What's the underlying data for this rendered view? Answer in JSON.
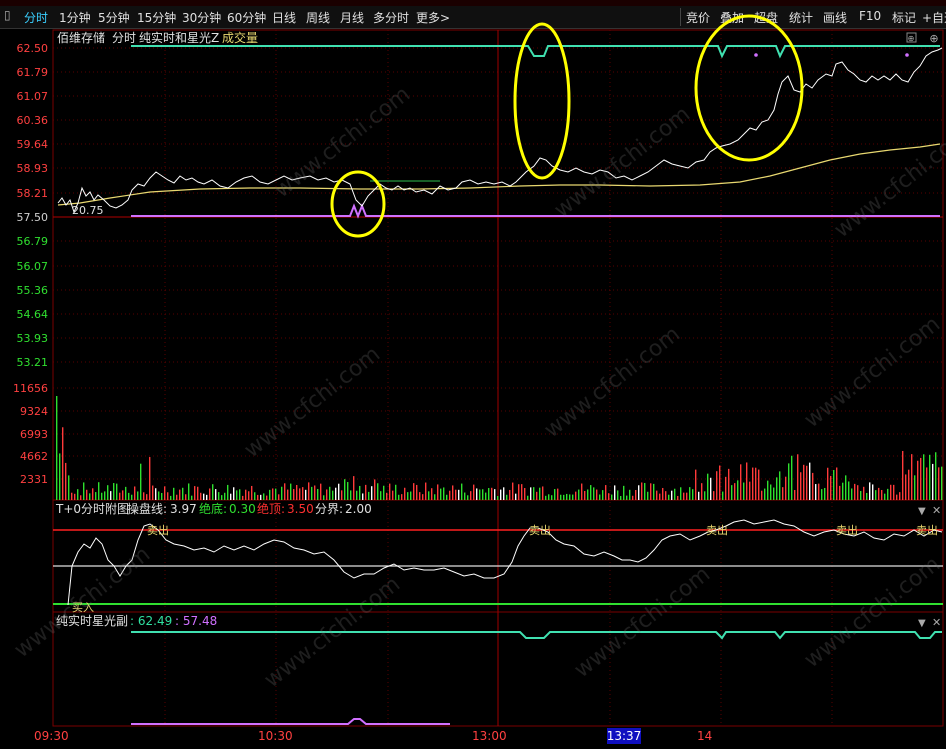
{
  "toolbar": {
    "tabs": [
      "分时",
      "1分钟",
      "5分钟",
      "15分钟",
      "30分钟",
      "60分钟",
      "日线",
      "周线",
      "月线",
      "多分时",
      "更多>"
    ],
    "right_tools": [
      "竞价",
      "叠加",
      "超盘",
      "统计",
      "画线",
      "F10",
      "标记",
      "+自选"
    ]
  },
  "main_panel": {
    "stock_name": "佰维存储",
    "indicator_names": [
      "分时",
      "纯实时和星光Z",
      "成交量"
    ],
    "price_ticks": [
      "62.50",
      "61.79",
      "61.07",
      "60.36",
      "59.64",
      "58.93",
      "58.21",
      "57.50",
      "56.79",
      "56.07",
      "55.36",
      "54.64",
      "53.93",
      "53.21"
    ],
    "pivot_label": "20.75",
    "volume_ticks": [
      "11656",
      "9324",
      "6993",
      "4662",
      "2331"
    ]
  },
  "sub_panel_1": {
    "title": "T+0分时附图",
    "items": [
      {
        "label": "操盘线:",
        "value": "3.97"
      },
      {
        "label": "绝底:",
        "value": "0.30"
      },
      {
        "label": "绝顶:",
        "value": "3.50"
      },
      {
        "label": "分界:",
        "value": "2.00"
      }
    ],
    "signals": [
      "卖出",
      "卖出",
      "卖出",
      "卖出",
      "卖出",
      "买入"
    ]
  },
  "sub_panel_2": {
    "title": "纯实时星光副",
    "values": [
      "62.49",
      "57.48"
    ]
  },
  "time_axis": {
    "labels": [
      "09:30",
      "10:30",
      "13:00",
      "14"
    ],
    "cursor_time": "13:37"
  },
  "watermark": "www.cfchi.com",
  "colors": {
    "background": "#000000",
    "price_line": "#ffffff",
    "avg_line": "#e8d870",
    "up": "#ff3a3a",
    "down": "#2ee02e",
    "cyan_line": "#40e0b0",
    "magenta_line": "#d070ff",
    "annotation": "#ffff00"
  },
  "chart_data": {
    "type": "line",
    "series": [],
    "ylim": [
      53.21,
      62.5
    ],
    "volume_ylim": [
      0,
      11656
    ],
    "grid": true
  }
}
